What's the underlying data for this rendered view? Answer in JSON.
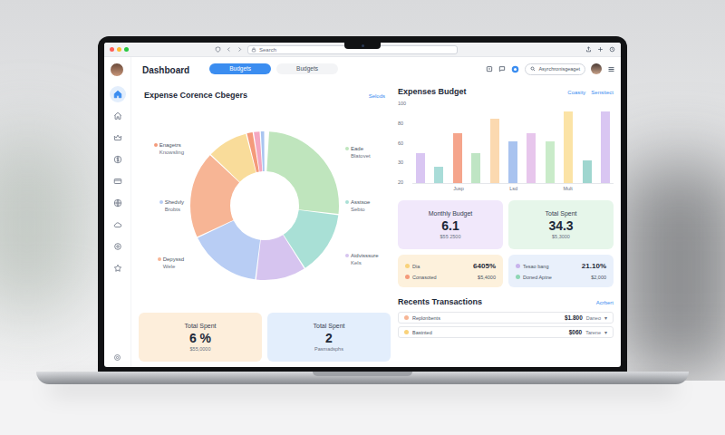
{
  "browser": {
    "address": "Search"
  },
  "header": {
    "title": "Dashboard",
    "tabs": [
      {
        "label": "Budgets",
        "selected": true
      },
      {
        "label": "Budgets",
        "selected": false
      }
    ],
    "search": {
      "text": "Asyrchronisgeaget"
    }
  },
  "sidebar": {
    "items": [
      {
        "selected": true
      },
      {
        "selected": false
      },
      {
        "selected": false
      },
      {
        "selected": false
      },
      {
        "selected": false
      },
      {
        "selected": false
      },
      {
        "selected": false
      },
      {
        "selected": false
      },
      {
        "selected": false
      }
    ]
  },
  "categories": {
    "title": "Expense Corence Cbegers",
    "link": "Selods",
    "chart": {
      "values": [
        26,
        14,
        11,
        16,
        19,
        9,
        1.5,
        1.5,
        1,
        1
      ],
      "colors": [
        "#bfe5bd",
        "#a9e0d6",
        "#d6c4ef",
        "#b8cdf4",
        "#f7b595",
        "#f9dc9a",
        "#f49a7a",
        "#f4a7c0",
        "#a9c5f0",
        "#c9c9d6"
      ]
    },
    "legend": {
      "left": [
        {
          "name": "Enagetrs",
          "sub": "Knowsling",
          "color": "#f49a7a"
        },
        {
          "name": "Shedvly",
          "sub": "Brobts",
          "color": "#b8cdf4"
        },
        {
          "name": "Depyssd",
          "sub": "Wele",
          "color": "#f7b595"
        }
      ],
      "right": [
        {
          "name": "Eade",
          "sub": "Blatovet",
          "color": "#bfe5bd"
        },
        {
          "name": "Asstsoe",
          "sub": "Sebto",
          "color": "#a9e0d6"
        },
        {
          "name": "Aidvisssure",
          "sub": "Kels",
          "color": "#d6c4ef"
        }
      ]
    }
  },
  "summary": [
    {
      "title": "Total Spent",
      "value": "6 %",
      "sub": "$55,0000",
      "color": "#fdeedb"
    },
    {
      "title": "Total Spent",
      "value": "2",
      "sub": "Pasmadsphs",
      "color": "#e3eefc"
    }
  ],
  "budget": {
    "title": "Expenses Budget",
    "links": [
      "Coasity",
      "Sensitect"
    ],
    "y_ticks": [
      "100",
      "80",
      "60",
      "30",
      "20"
    ],
    "x_labels": [
      "Jusp",
      "Lsd",
      "Mult"
    ],
    "values": [
      37,
      20,
      63,
      37,
      81,
      52,
      62,
      52,
      90,
      28,
      90
    ],
    "colors": [
      "#d9c6f2",
      "#a9dcd8",
      "#f5a58c",
      "#bfe5c4",
      "#fbd9b0",
      "#a9c3ef",
      "#e7c6ec",
      "#c9ebc9",
      "#fbe3a6",
      "#9fd6cf",
      "#d9c6f2"
    ]
  },
  "stats": [
    {
      "title": "Monthly Budget",
      "value": "6.1",
      "sub": "$55 2500",
      "color": "#f1e8fb"
    },
    {
      "title": "Total Spent",
      "value": "34.3",
      "sub": "$5,3000",
      "color": "#e6f6ea"
    }
  ],
  "mini": [
    {
      "color": "#fdf1dc",
      "rows": [
        {
          "label": "Dia",
          "value": "6405%",
          "color": "#f9d27a"
        },
        {
          "label": "Conasoted",
          "value": "$5,4000",
          "color": "#f49a7a"
        }
      ]
    },
    {
      "color": "#e9f0fb",
      "rows": [
        {
          "label": "Tesao bang",
          "value": "21.10%",
          "color": "#c8b3ec"
        },
        {
          "label": "Doned Aptne",
          "value": "$2,000",
          "color": "#8fd6b5"
        }
      ]
    }
  ],
  "transactions": {
    "title": "Recents Transactions",
    "link": "Acrbert",
    "rows": [
      {
        "name": "Replonbents",
        "amount": "$1.800",
        "note": "Daneo",
        "caret": "▾",
        "color": "#f7b595"
      },
      {
        "name": "Bastnted",
        "amount": "$060",
        "note": "Tarene",
        "caret": "▾",
        "color": "#f9d27a"
      }
    ]
  }
}
